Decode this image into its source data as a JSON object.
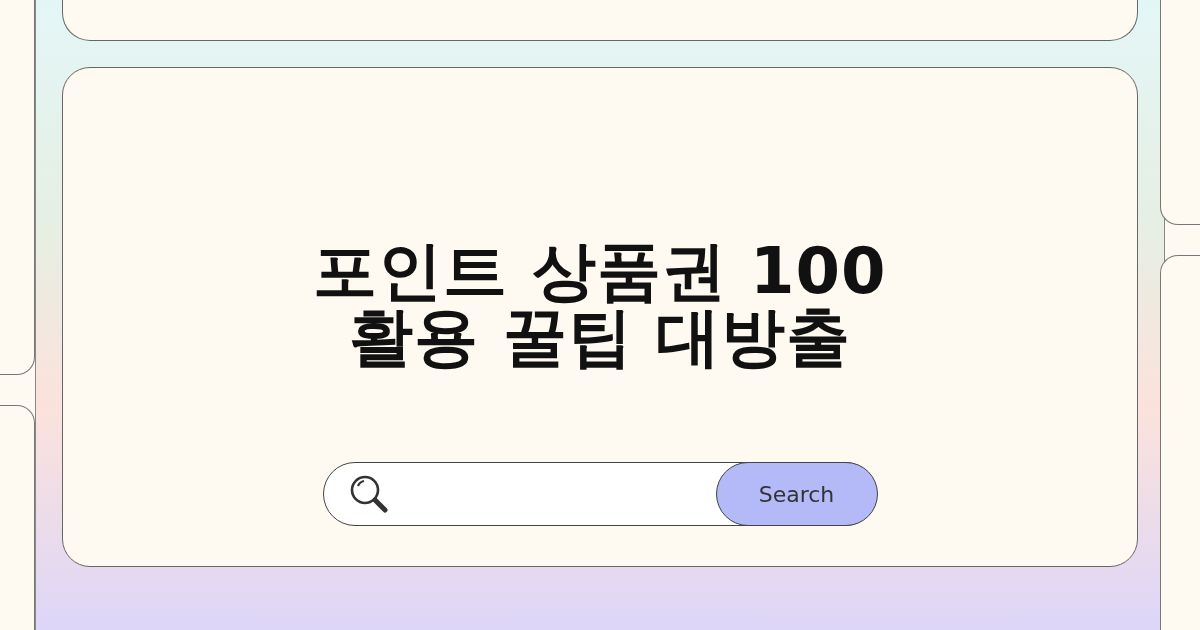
{
  "title_lines": [
    "포인트 상품권 100",
    "활용 꿀팁 대방출"
  ],
  "search": {
    "button": "Search"
  }
}
